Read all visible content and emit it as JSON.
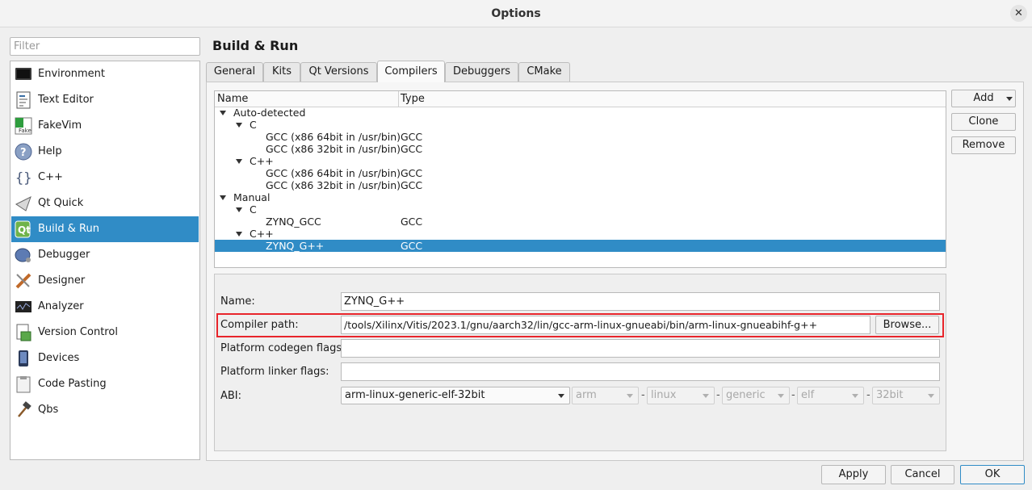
{
  "window": {
    "title": "Options"
  },
  "filter": {
    "placeholder": "Filter"
  },
  "categories": [
    {
      "label": "Environment",
      "icon": "monitor-icon"
    },
    {
      "label": "Text Editor",
      "icon": "text-editor-icon"
    },
    {
      "label": "FakeVim",
      "icon": "fakevim-icon"
    },
    {
      "label": "Help",
      "icon": "help-icon"
    },
    {
      "label": "C++",
      "icon": "braces-icon"
    },
    {
      "label": "Qt Quick",
      "icon": "qt-quick-icon"
    },
    {
      "label": "Build & Run",
      "icon": "build-run-icon",
      "selected": true
    },
    {
      "label": "Debugger",
      "icon": "debugger-icon"
    },
    {
      "label": "Designer",
      "icon": "designer-icon"
    },
    {
      "label": "Analyzer",
      "icon": "analyzer-icon"
    },
    {
      "label": "Version Control",
      "icon": "version-control-icon"
    },
    {
      "label": "Devices",
      "icon": "devices-icon"
    },
    {
      "label": "Code Pasting",
      "icon": "code-pasting-icon"
    },
    {
      "label": "Qbs",
      "icon": "hammer-icon"
    }
  ],
  "page": {
    "heading": "Build & Run"
  },
  "tabs": [
    "General",
    "Kits",
    "Qt Versions",
    "Compilers",
    "Debuggers",
    "CMake"
  ],
  "active_tab": "Compilers",
  "tree": {
    "col_name": "Name",
    "col_type": "Type",
    "rows": [
      {
        "name": "Auto-detected",
        "type": "",
        "level": 0,
        "expanded": true
      },
      {
        "name": "C",
        "type": "",
        "level": 1,
        "expanded": true
      },
      {
        "name": "GCC (x86 64bit in /usr/bin)",
        "type": "GCC",
        "level": 2
      },
      {
        "name": "GCC (x86 32bit in /usr/bin)",
        "type": "GCC",
        "level": 2
      },
      {
        "name": "C++",
        "type": "",
        "level": 1,
        "expanded": true
      },
      {
        "name": "GCC (x86 64bit in /usr/bin)",
        "type": "GCC",
        "level": 2
      },
      {
        "name": "GCC (x86 32bit in /usr/bin)",
        "type": "GCC",
        "level": 2
      },
      {
        "name": "Manual",
        "type": "",
        "level": 0,
        "expanded": true
      },
      {
        "name": "C",
        "type": "",
        "level": 1,
        "expanded": true
      },
      {
        "name": "ZYNQ_GCC",
        "type": "GCC",
        "level": 2
      },
      {
        "name": "C++",
        "type": "",
        "level": 1,
        "expanded": true
      },
      {
        "name": "ZYNQ_G++",
        "type": "GCC",
        "level": 2,
        "selected": true
      }
    ]
  },
  "side_buttons": {
    "add": "Add",
    "clone": "Clone",
    "remove": "Remove"
  },
  "details": {
    "name_label": "Name:",
    "name_value": "ZYNQ_G++",
    "path_label": "Compiler path:",
    "path_value": "/tools/Xilinx/Vitis/2023.1/gnu/aarch32/lin/gcc-arm-linux-gnueabi/bin/arm-linux-gnueabihf-g++",
    "browse": "Browse...",
    "codegen_label": "Platform codegen flags:",
    "codegen_value": "",
    "linker_label": "Platform linker flags:",
    "linker_value": "",
    "abi_label": "ABI:",
    "abi_value": "arm-linux-generic-elf-32bit",
    "abi_parts": [
      "arm",
      "linux",
      "generic",
      "elf",
      "32bit"
    ],
    "separator": "-"
  },
  "footer": {
    "apply": "Apply",
    "cancel": "Cancel",
    "ok": "OK"
  },
  "colors": {
    "selection": "#308cc6",
    "highlight_box": "#e8252b"
  }
}
